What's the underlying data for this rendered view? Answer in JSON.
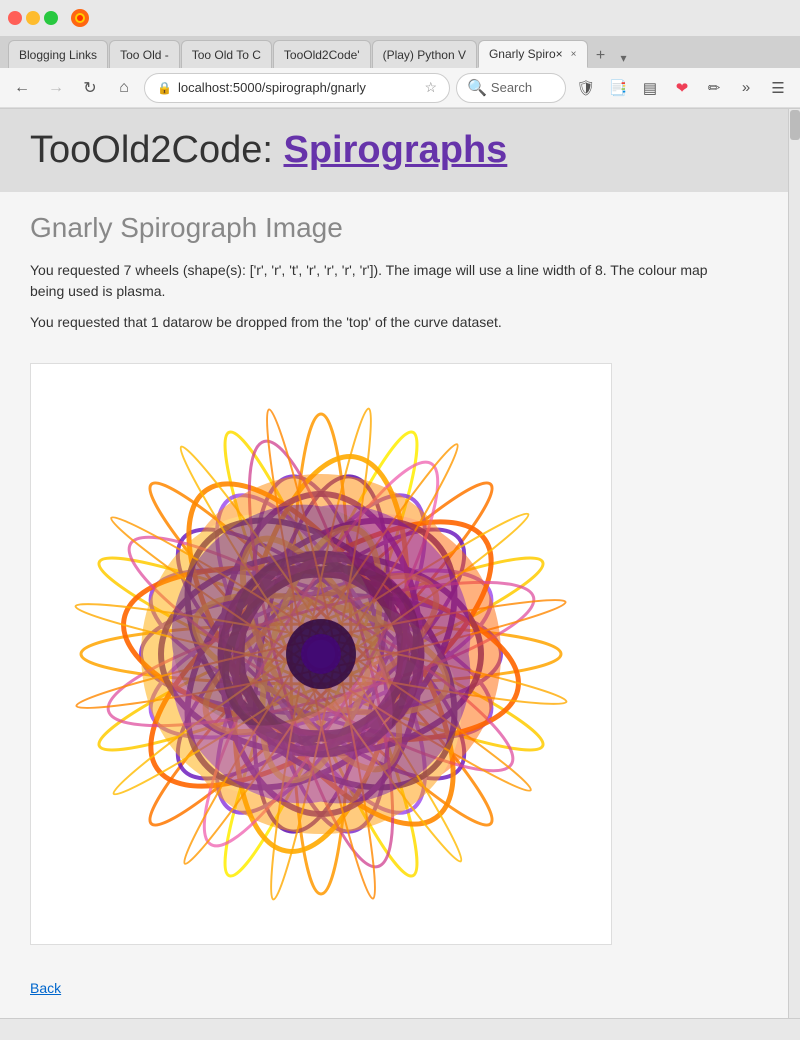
{
  "browser": {
    "tabs": [
      {
        "id": "tab1",
        "label": "Blogging Links",
        "active": false,
        "closable": false
      },
      {
        "id": "tab2",
        "label": "Too Old - ",
        "active": false,
        "closable": false
      },
      {
        "id": "tab3",
        "label": "Too Old To C",
        "active": false,
        "closable": false
      },
      {
        "id": "tab4",
        "label": "TooOld2Code'",
        "active": false,
        "closable": false
      },
      {
        "id": "tab5",
        "label": "(Play) Python V",
        "active": false,
        "closable": false
      },
      {
        "id": "tab6",
        "label": "Gnarly Spiro×",
        "active": true,
        "closable": true
      }
    ],
    "nav": {
      "back_disabled": false,
      "forward_disabled": true,
      "url": "localhost:5000/spirograph/gnarly",
      "search_placeholder": "Search"
    }
  },
  "page": {
    "site_name": "TooOld2Code:",
    "site_link_text": "Spirographs",
    "section_title": "Gnarly Spirograph Image",
    "info_line1": "You requested 7 wheels (shape(s): ['r', 'r', 't', 'r', 'r', 'r', 'r']).  The image will use a line width of 8.  The colour map being used is plasma.",
    "info_line2": "You requested that 1 datarow be dropped from the 'top' of the curve dataset.",
    "back_link": "Back"
  },
  "colors": {
    "accent": "#6633aa",
    "link": "#0066cc"
  }
}
